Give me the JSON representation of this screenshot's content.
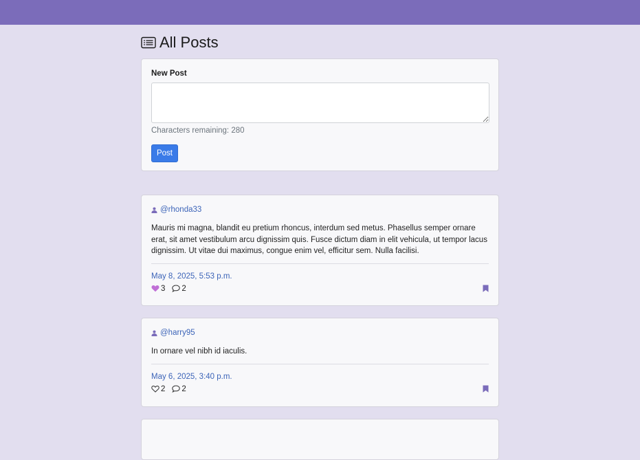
{
  "colors": {
    "topbar": "#7b6cba",
    "background": "#e2deef",
    "accent": "#7b6cba",
    "link": "#3c64b8",
    "button": "#3a7be8",
    "liked": "#c06fd6"
  },
  "page": {
    "title": "All Posts",
    "icon": "list-icon"
  },
  "new_post": {
    "label": "New Post",
    "textarea_value": "",
    "remaining_text": "Characters remaining: 280",
    "submit_label": "Post"
  },
  "posts": [
    {
      "author": "@rhonda33",
      "body": "Mauris mi magna, blandit eu pretium rhoncus, interdum sed metus. Phasellus semper ornare erat, sit amet vestibulum arcu dignissim quis. Fusce dictum diam in elit vehicula, ut tempor lacus dignissim. Ut vitae dui maximus, congue enim vel, efficitur sem. Nulla facilisi.",
      "date": "May 8, 2025, 5:53 p.m.",
      "likes": "3",
      "liked": true,
      "comments": "2",
      "bookmarked": true
    },
    {
      "author": "@harry95",
      "body": "In ornare vel nibh id iaculis.",
      "date": "May 6, 2025, 3:40 p.m.",
      "likes": "2",
      "liked": false,
      "comments": "2",
      "bookmarked": true
    }
  ]
}
